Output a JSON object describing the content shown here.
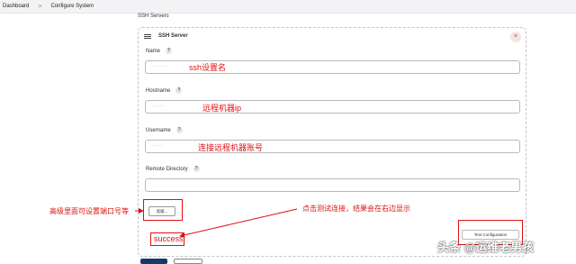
{
  "breadcrumb": {
    "items": [
      "Dashboard",
      "Configure System"
    ],
    "separator": ">"
  },
  "section_title": "SSH Servers",
  "server": {
    "header": "SSH Server",
    "close_symbol": "×",
    "fields": {
      "name": {
        "label": "Name",
        "help": "?",
        "value": "·············"
      },
      "hostname": {
        "label": "Hostname",
        "help": "?",
        "value": "···········"
      },
      "username": {
        "label": "Username",
        "help": "?",
        "value": "·········"
      },
      "remote_directory": {
        "label": "Remote Directory",
        "help": "?",
        "value": ""
      }
    },
    "advanced_button": "高级...",
    "test_button": "Test Configuration"
  },
  "annotations": {
    "name_note": "ssh设置名",
    "hostname_note": "远程机器ip",
    "username_note": "连接远程机器账号",
    "advanced_note": "高级里面可设置端口号等",
    "test_note": "点击测试连接，结果会在右边显示",
    "result": "success",
    "color": "#e01010"
  },
  "watermark": "头条 @运维老男孩"
}
